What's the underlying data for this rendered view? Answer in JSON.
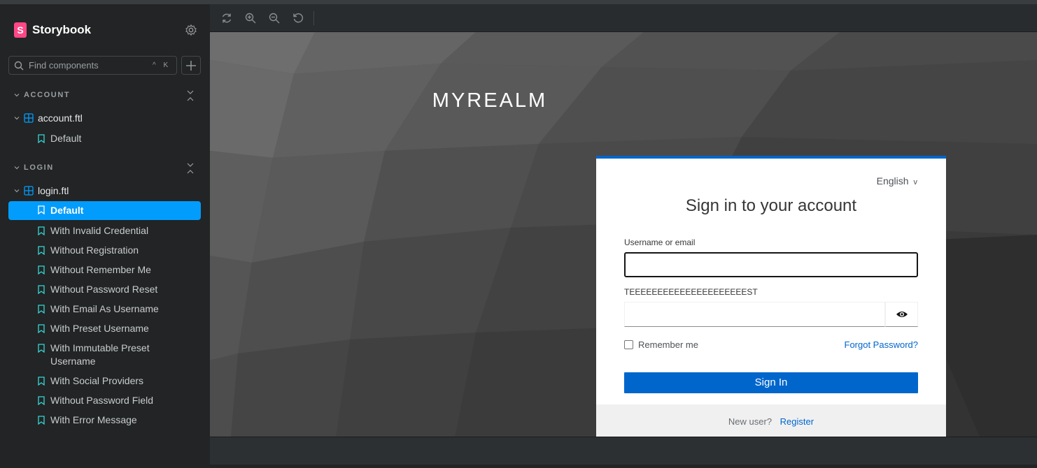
{
  "sidebar": {
    "brand": "Storybook",
    "search": {
      "placeholder": "Find components",
      "shortcut": "^ K"
    },
    "groups": [
      {
        "label": "ACCOUNT",
        "component": "account.ftl",
        "stories": [
          "Default"
        ]
      },
      {
        "label": "LOGIN",
        "component": "login.ftl",
        "stories": [
          "Default",
          "With Invalid Credential",
          "Without Registration",
          "Without Remember Me",
          "Without Password Reset",
          "With Email As Username",
          "With Preset Username",
          "With Immutable Preset Username",
          "With Social Providers",
          "Without Password Field",
          "With Error Message"
        ]
      }
    ],
    "active_story": "login.ftl / Default"
  },
  "preview": {
    "realm": "MYREALM",
    "card": {
      "language": "English",
      "title": "Sign in to your account",
      "username_label": "Username or email",
      "username_value": "",
      "password_label": "TEEEEEEEEEEEEEEEEEEEEEST",
      "password_value": "",
      "remember_label": "Remember me",
      "forgot_label": "Forgot Password?",
      "signin_label": "Sign In",
      "new_user_label": "New user?",
      "register_label": "Register"
    }
  },
  "colors": {
    "accent": "#029cfd",
    "brand": "#ff4785",
    "primary_button": "#0066cc"
  }
}
